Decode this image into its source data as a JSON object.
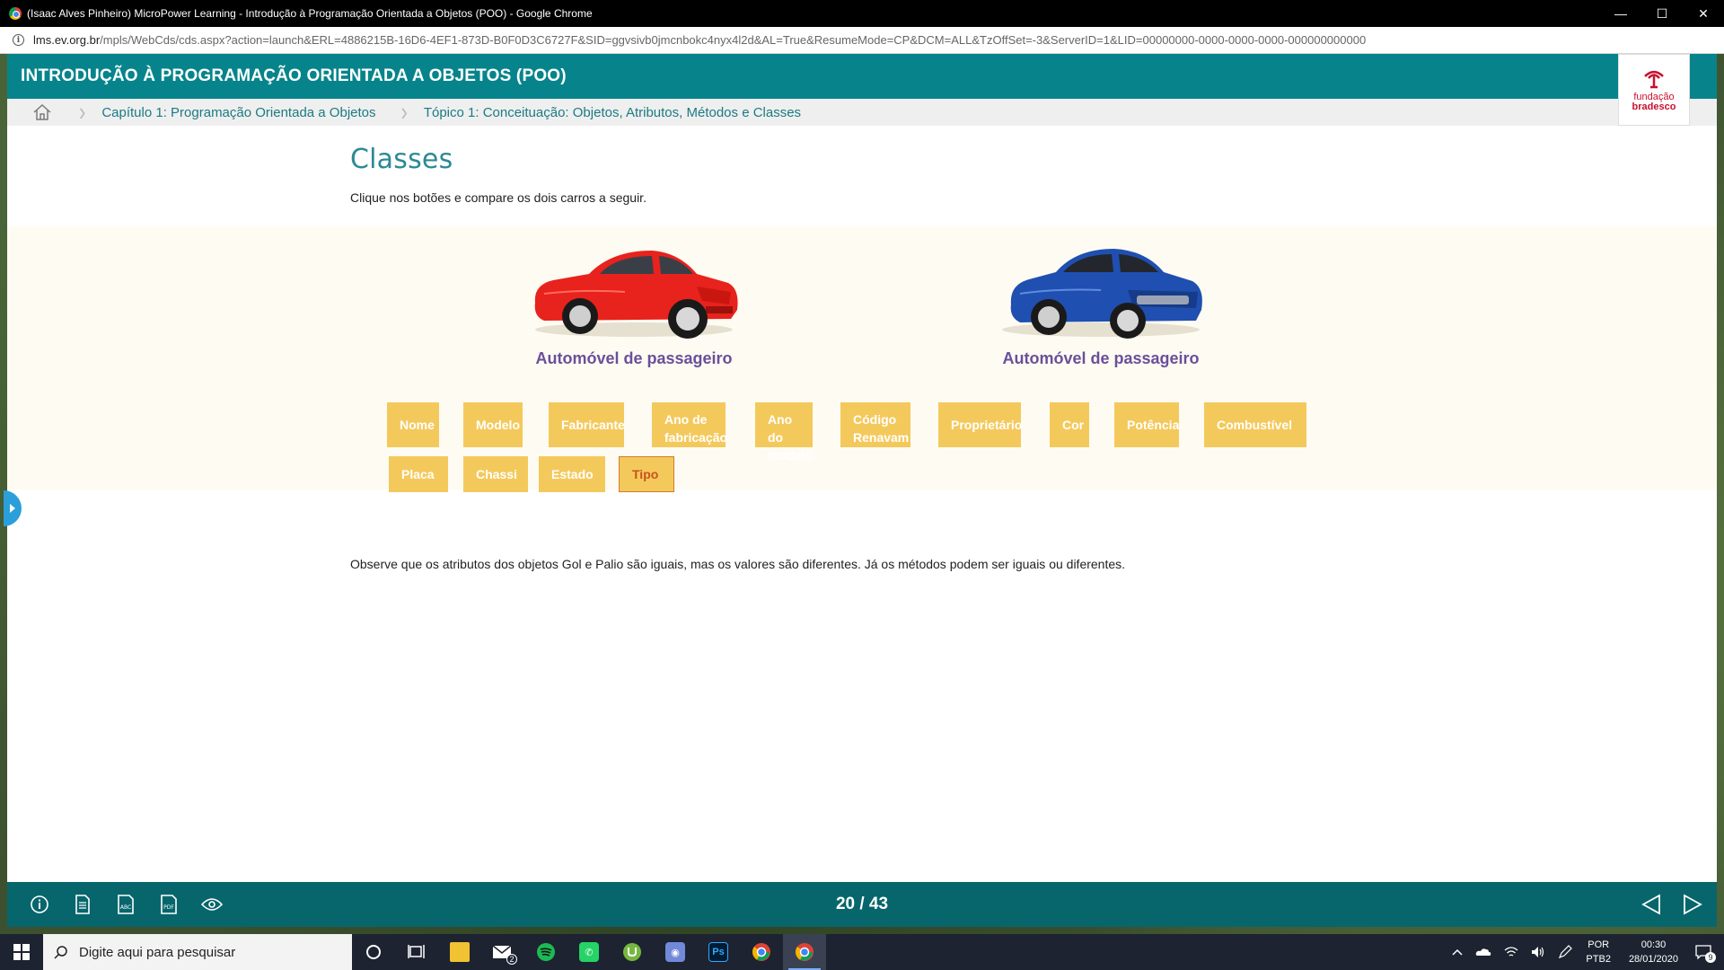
{
  "window": {
    "title": "(Isaac Alves Pinheiro) MicroPower Learning - Introdução à Programação Orientada a Objetos (POO) - Google Chrome",
    "minimize": "—",
    "maximize": "☐",
    "close": "✕"
  },
  "address": {
    "host": "lms.ev.org.br",
    "path": "/mpls/WebCds/cds.aspx?action=launch&ERL=4886215B-16D6-4EF1-873D-B0F0D3C6727F&SID=ggvsivb0jmcnbokc4nyx4l2d&AL=True&ResumeMode=CP&DCM=ALL&TzOffSet=-3&ServerID=1&LID=00000000-0000-0000-0000-000000000000"
  },
  "course": {
    "title": "INTRODUÇÃO À PROGRAMAÇÃO ORIENTADA A OBJETOS (POO)",
    "logo_line1": "fundação",
    "logo_line2": "bradesco",
    "brand_color": "#07848b"
  },
  "breadcrumb": {
    "chapter": "Capítulo 1: Programação Orientada a Objetos",
    "topic": "Tópico 1: Conceituação: Objetos, Atributos, Métodos e Classes"
  },
  "content": {
    "title": "Classes",
    "instruction": "Clique nos botões e compare os dois carros a seguir.",
    "cars": [
      {
        "label": "Automóvel de passageiro",
        "color": "#e8221c"
      },
      {
        "label": "Automóvel de passageiro",
        "color": "#1f4fb0"
      }
    ],
    "attributes_row1": [
      "Nome",
      "Modelo",
      "Fabricante",
      "Ano de fabricação",
      "Ano do modelo",
      "Código Renavam",
      "Proprietário",
      "Cor",
      "Potência",
      "Combustível"
    ],
    "attributes_row2": [
      "Placa",
      "Chassi",
      "Estado",
      "Tipo"
    ],
    "active_attribute": "Tipo",
    "observation": "Observe que os atributos dos objetos Gol e Palio são iguais, mas os valores são diferentes. Já os métodos podem ser iguais ou diferentes."
  },
  "player": {
    "page_counter": "20 / 43",
    "tools": [
      "info-icon",
      "document-icon",
      "glossary-icon",
      "pdf-icon",
      "eye-icon"
    ]
  },
  "taskbar": {
    "search_placeholder": "Digite aqui para pesquisar",
    "lang_line1": "POR",
    "lang_line2": "PTB2",
    "time": "00:30",
    "date": "28/01/2020",
    "notification_count": "9",
    "mail_badge": "2"
  }
}
